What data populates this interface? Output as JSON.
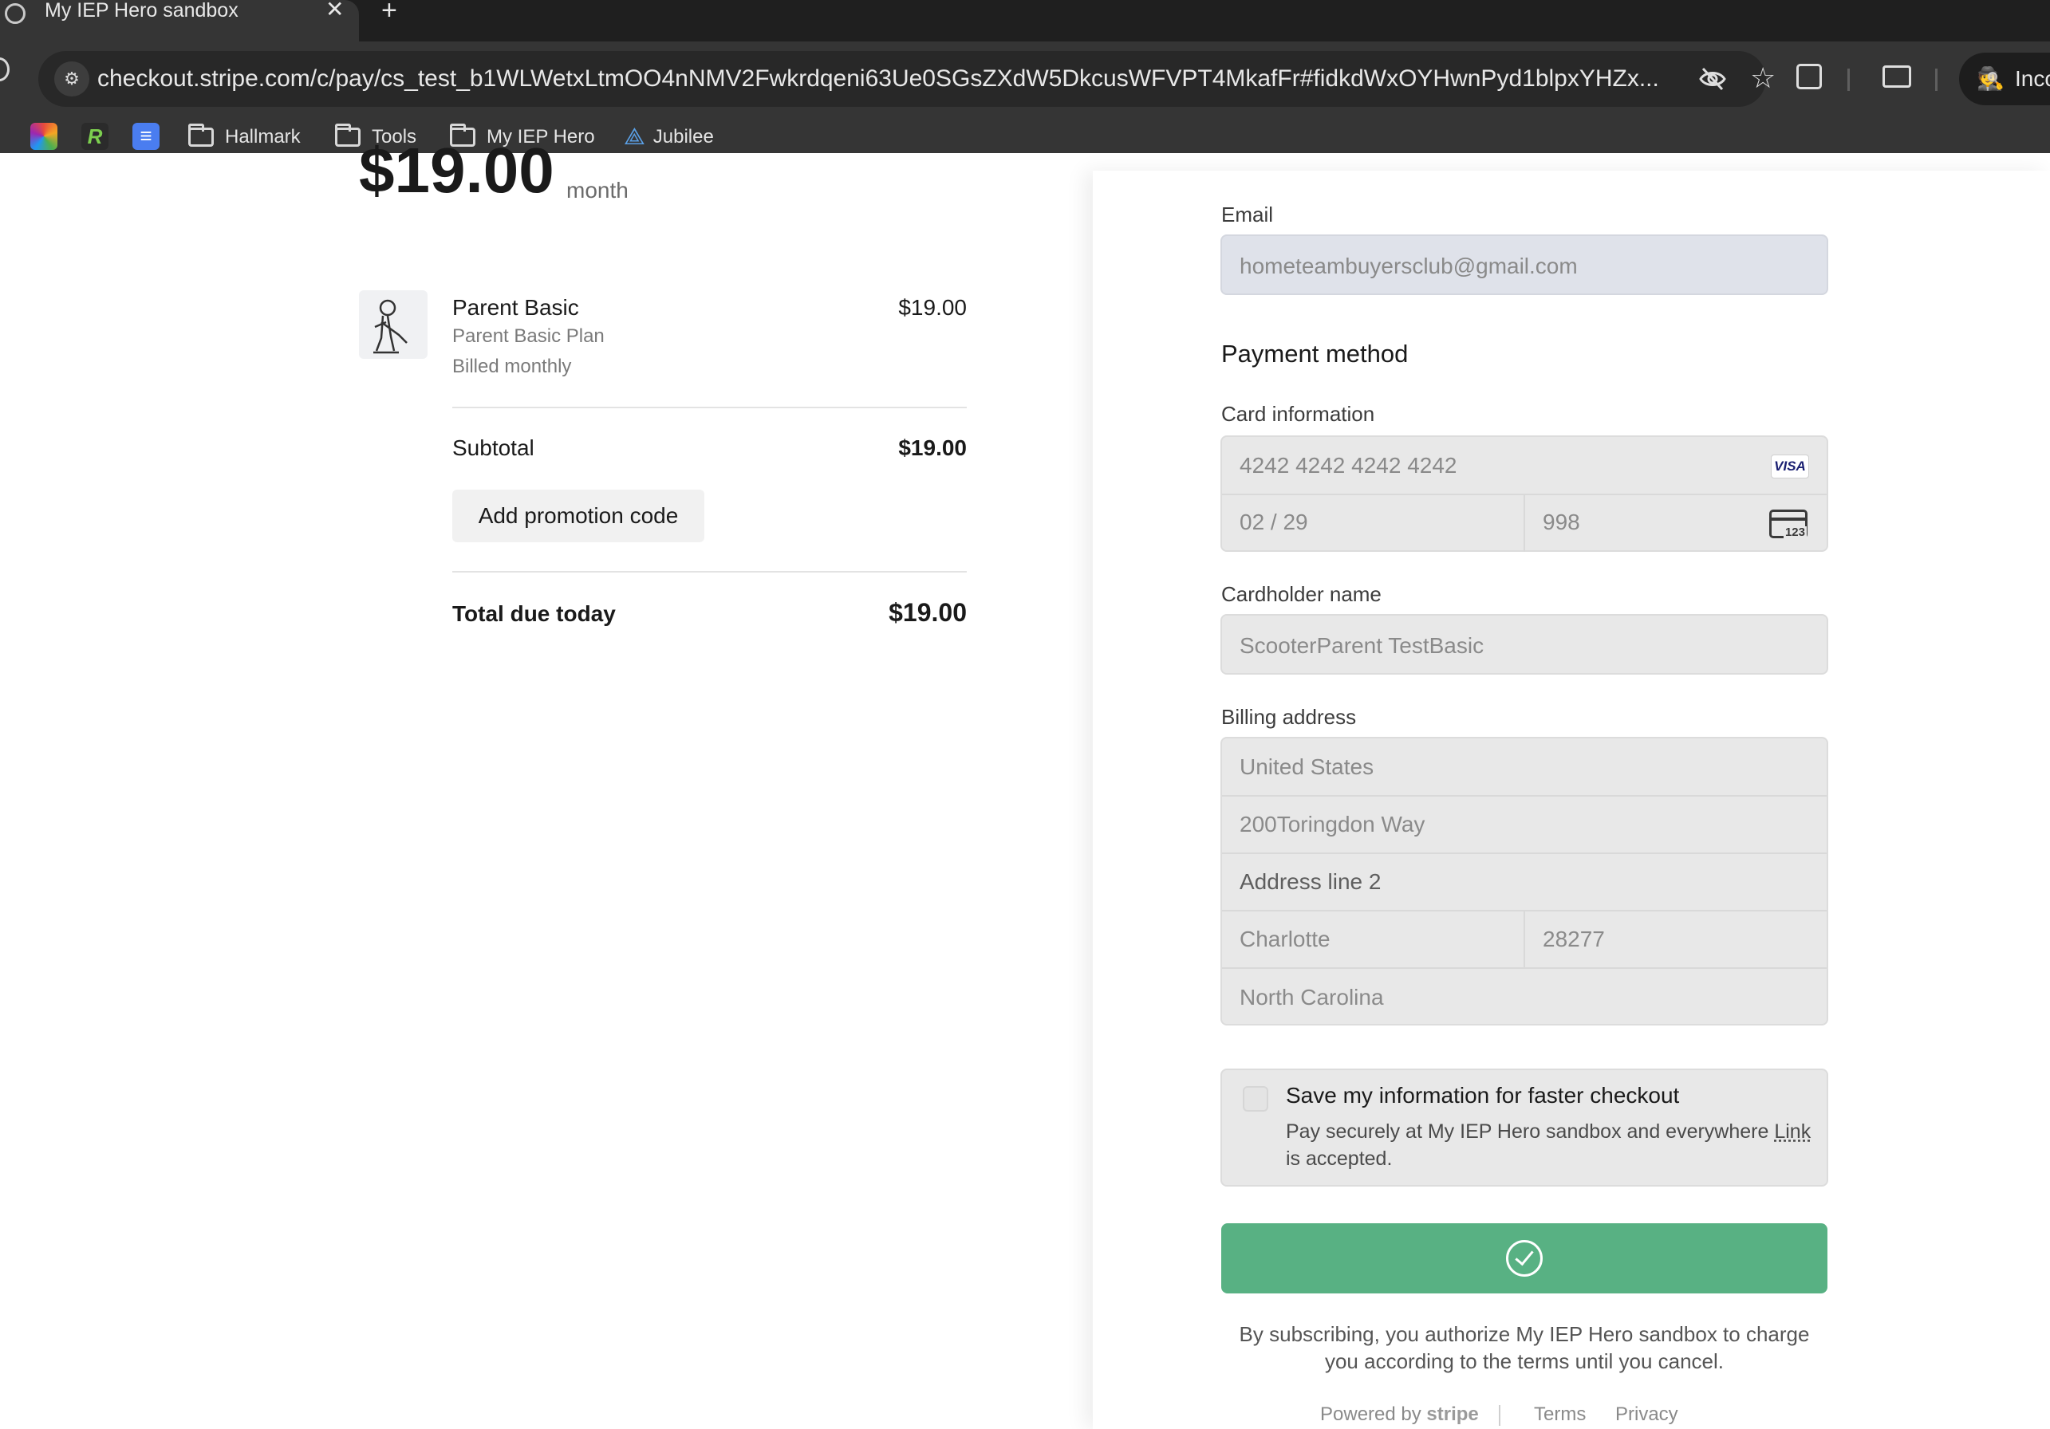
{
  "browser": {
    "tab_title": "My IEP Hero sandbox",
    "tab_close": "✕",
    "new_tab": "+",
    "url": "checkout.stripe.com/c/pay/cs_test_b1WLWetxLtmOO4nNMV2Fwkrdqeni63Ue0SGsZXdW5DkcusWFVPT4MkafFr#fidkdWxOYHwnPyd1blpxYHZx...",
    "incognito_label": "Inco",
    "bookmarks": [
      {
        "label": "Hallmark"
      },
      {
        "label": "Tools"
      },
      {
        "label": "My IEP Hero"
      },
      {
        "label": "Jubilee"
      }
    ]
  },
  "summary": {
    "price": "$19.00",
    "price_period": "month",
    "line_item": {
      "name": "Parent Basic",
      "description": "Parent Basic Plan",
      "billing": "Billed monthly",
      "price": "$19.00"
    },
    "subtotal_label": "Subtotal",
    "subtotal_value": "$19.00",
    "promo_button": "Add promotion code",
    "total_label": "Total due today",
    "total_value": "$19.00"
  },
  "form": {
    "email_label": "Email",
    "email_value": "hometeambuyersclub@gmail.com",
    "payment_title": "Payment method",
    "card_label": "Card information",
    "card_number": "4242 4242 4242 4242",
    "card_brand": "VISA",
    "expiry": "02 / 29",
    "cvc": "998",
    "cvc_icon_text": "123",
    "cardholder_label": "Cardholder name",
    "cardholder_value": "ScooterParent TestBasic",
    "billing_label": "Billing address",
    "country": "United States",
    "address_line1": "200Toringdon Way",
    "address_line2_placeholder": "Address line 2",
    "city": "Charlotte",
    "zip": "28277",
    "state": "North Carolina",
    "save_title": "Save my information for faster checkout",
    "save_desc_prefix": "Pay securely at My IEP Hero sandbox and everywhere ",
    "save_desc_link": "Link",
    "save_desc_suffix": " is accepted.",
    "legal_text": "By subscribing, you authorize My IEP Hero sandbox to charge you according to the terms until you cancel.",
    "powered_by": "Powered by",
    "powered_brand": "stripe",
    "terms": "Terms",
    "privacy": "Privacy"
  },
  "colors": {
    "subscribe_button": "#58b183",
    "browser_chrome": "#353535"
  }
}
